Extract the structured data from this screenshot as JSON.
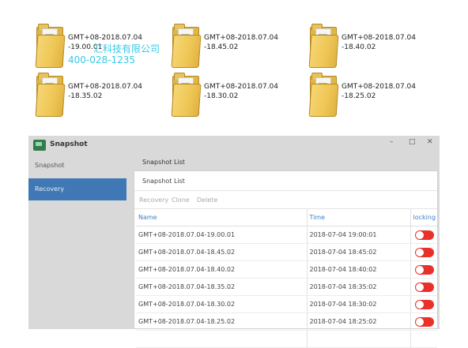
{
  "folders": [
    {
      "line1": "GMT+08-2018.07.04",
      "line2": "-19.00.01"
    },
    {
      "line1": "GMT+08-2018.07.04",
      "line2": "-18.45.02"
    },
    {
      "line1": "GMT+08-2018.07.04",
      "line2": "-18.40.02"
    },
    {
      "line1": "GMT+08-2018.07.04",
      "line2": "-18.35.02"
    },
    {
      "line1": "GMT+08-2018.07.04",
      "line2": "-18.30.02"
    },
    {
      "line1": "GMT+08-2018.07.04",
      "line2": "-18.25.02"
    }
  ],
  "watermark": {
    "company": "汇科技有限公司",
    "phone": "400-028-1235"
  },
  "window": {
    "title": "Snapshot",
    "minimize": "–",
    "maximize": "□",
    "close": "✕"
  },
  "sidebar": {
    "items": [
      {
        "label": "Snapshot"
      },
      {
        "label": "Recovery"
      }
    ]
  },
  "content": {
    "title": "Snapshot List"
  },
  "panel": {
    "header": "Snapshot List",
    "toolbar": {
      "recovery": "Recovery",
      "clone": "Clone",
      "delete": "Delete"
    },
    "columns": {
      "name": "Name",
      "time": "Time",
      "locking": "locking"
    },
    "rows": [
      {
        "name": "GMT+08-2018.07.04-19.00.01",
        "time": "2018-07-04 19:00:01",
        "locked": false
      },
      {
        "name": "GMT+08-2018.07.04-18.45.02",
        "time": "2018-07-04 18:45:02",
        "locked": false
      },
      {
        "name": "GMT+08-2018.07.04-18.40.02",
        "time": "2018-07-04 18:40:02",
        "locked": false
      },
      {
        "name": "GMT+08-2018.07.04-18.35.02",
        "time": "2018-07-04 18:35:02",
        "locked": false
      },
      {
        "name": "GMT+08-2018.07.04-18.30.02",
        "time": "2018-07-04 18:30:02",
        "locked": false
      },
      {
        "name": "GMT+08-2018.07.04-18.25.02",
        "time": "2018-07-04 18:25:02",
        "locked": false
      }
    ]
  },
  "colors": {
    "active_sidebar": "#3f78b4",
    "toggle_off": "#e8312a",
    "header_text": "#3a7fc4",
    "folder": "#eec655"
  }
}
